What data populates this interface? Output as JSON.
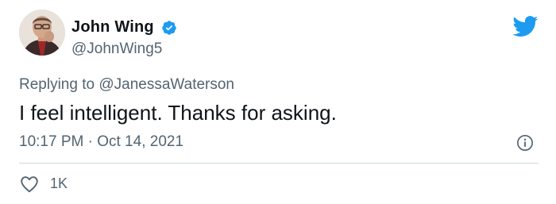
{
  "user": {
    "display_name": "John Wing",
    "handle": "@JohnWing5",
    "verified": true,
    "avatar": "profile-photo"
  },
  "tweet": {
    "replying_prefix": "Replying to",
    "replying_to": "@JanessaWaterson",
    "text": "I feel intelligent. Thanks for asking.",
    "time": "10:17 PM",
    "separator": "·",
    "date": "Oct 14, 2021"
  },
  "actions": {
    "like_icon": "heart-outline-icon",
    "like_count": "1K"
  },
  "icons": {
    "brand": "twitter-bird-icon",
    "info": "info-circle-icon",
    "verified": "verified-badge-icon"
  },
  "colors": {
    "brand_blue": "#1d9bf0",
    "secondary_text": "#536471",
    "primary_text": "#0f1419",
    "divider": "#cfd9de"
  }
}
